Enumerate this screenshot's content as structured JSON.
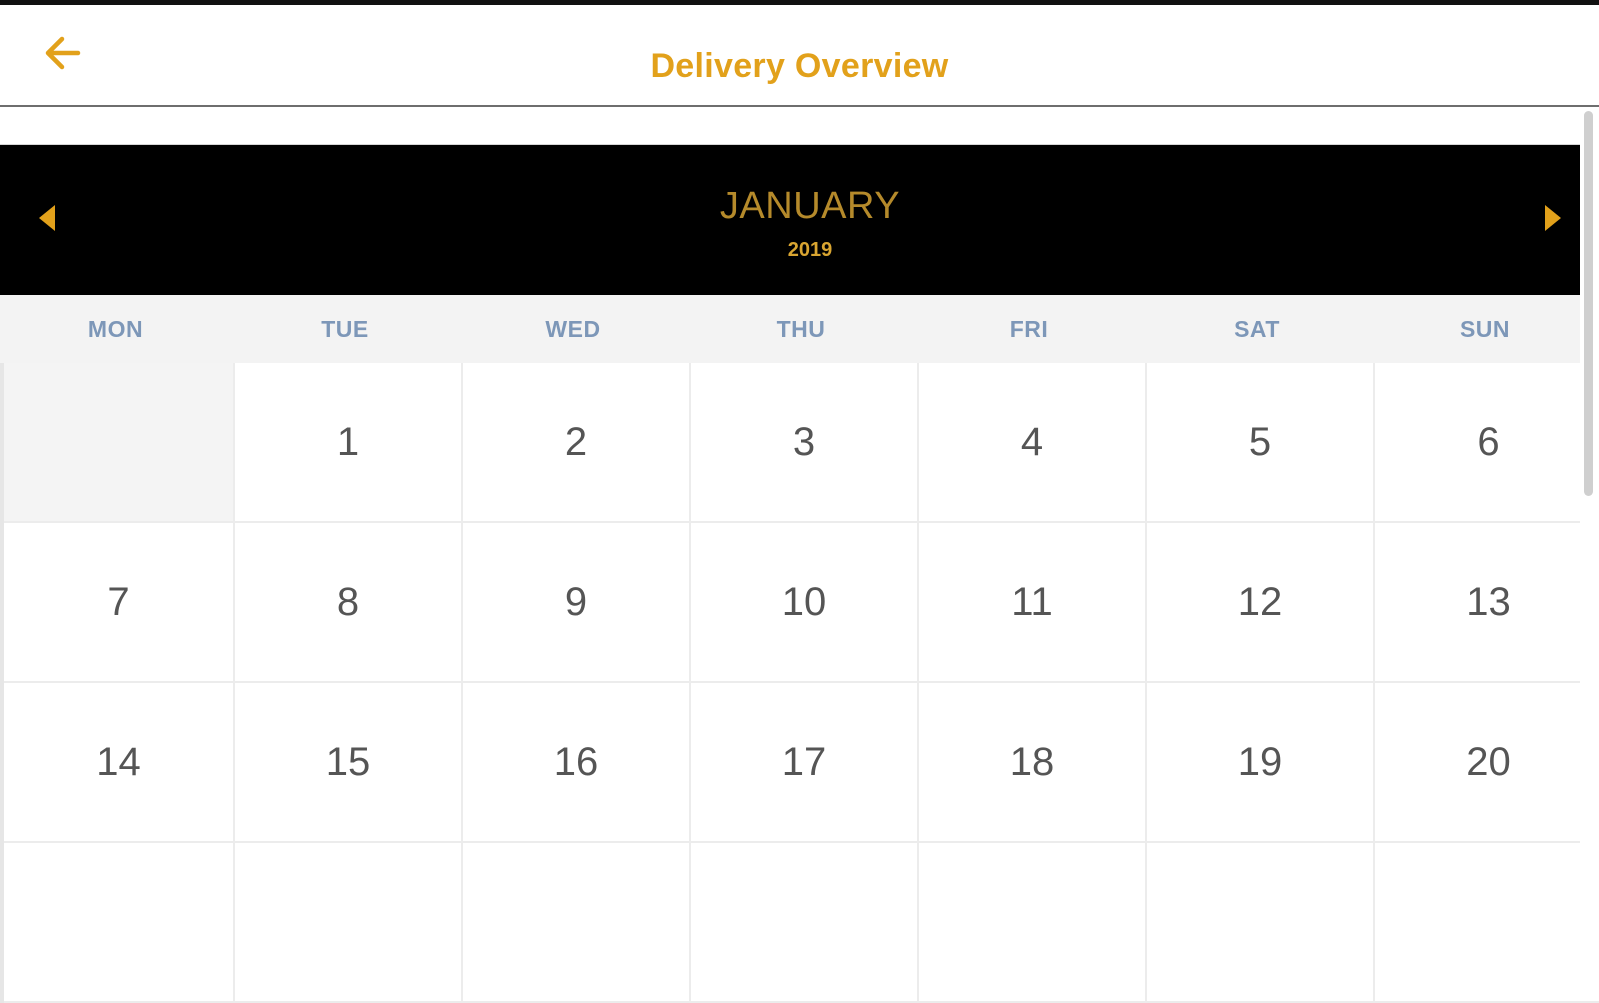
{
  "header": {
    "title": "Delivery Overview",
    "back_icon": "arrow-left-icon",
    "accent_color": "#e2a11b"
  },
  "calendar": {
    "month": "JANUARY",
    "year": "2019",
    "prev_icon": "triangle-left-icon",
    "next_icon": "triangle-right-icon",
    "weekdays": [
      "MON",
      "TUE",
      "WED",
      "THU",
      "FRI",
      "SAT",
      "SUN"
    ],
    "weeks": [
      [
        "",
        "1",
        "2",
        "3",
        "4",
        "5",
        "6"
      ],
      [
        "7",
        "8",
        "9",
        "10",
        "11",
        "12",
        "13"
      ],
      [
        "14",
        "15",
        "16",
        "17",
        "18",
        "19",
        "20"
      ],
      [
        "",
        "",
        "",
        "",
        "",
        "",
        ""
      ]
    ]
  }
}
